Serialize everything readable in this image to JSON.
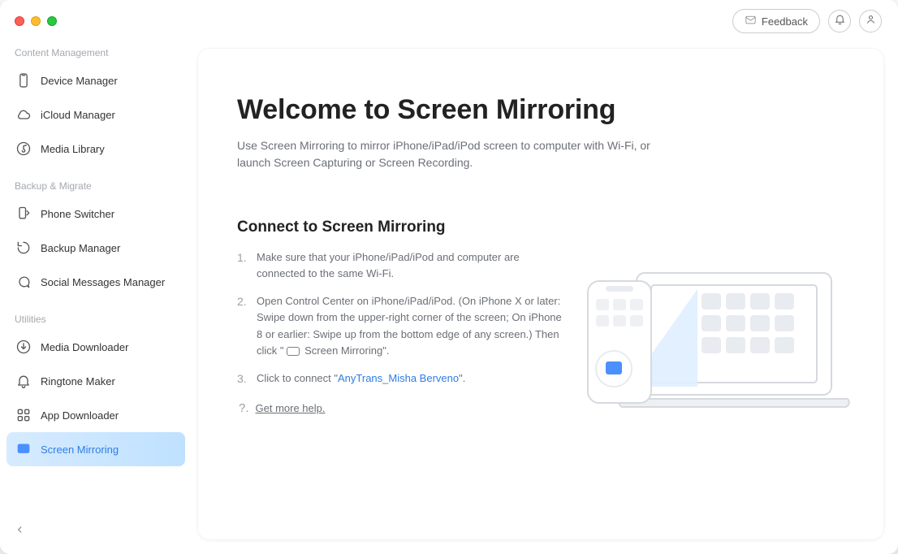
{
  "titlebar": {
    "feedback_label": "Feedback"
  },
  "sidebar": {
    "sections": [
      {
        "title": "Content Management",
        "items": [
          {
            "label": "Device Manager"
          },
          {
            "label": "iCloud Manager"
          },
          {
            "label": "Media Library"
          }
        ]
      },
      {
        "title": "Backup & Migrate",
        "items": [
          {
            "label": "Phone Switcher"
          },
          {
            "label": "Backup Manager"
          },
          {
            "label": "Social Messages Manager"
          }
        ]
      },
      {
        "title": "Utilities",
        "items": [
          {
            "label": "Media Downloader"
          },
          {
            "label": "Ringtone Maker"
          },
          {
            "label": "App Downloader"
          },
          {
            "label": "Screen Mirroring"
          }
        ]
      }
    ]
  },
  "main": {
    "title": "Welcome to Screen Mirroring",
    "subtitle": "Use Screen Mirroring to mirror iPhone/iPad/iPod screen to computer with Wi-Fi, or launch Screen Capturing or Screen Recording.",
    "connect_heading": "Connect to Screen Mirroring",
    "steps": {
      "step1": "Make sure that your iPhone/iPad/iPod and computer are connected to the same Wi-Fi.",
      "step2_a": "Open Control Center on iPhone/iPad/iPod. (On iPhone X or later: Swipe down from the upper-right corner of the screen; On iPhone 8 or earlier: Swipe up from the bottom edge of any screen.) Then click \"",
      "step2_b": " Screen Mirroring\".",
      "step3_a": "Click to connect \"",
      "step3_link": "AnyTrans_Misha Berveno",
      "step3_b": "\"."
    },
    "help_label": "Get more help."
  }
}
